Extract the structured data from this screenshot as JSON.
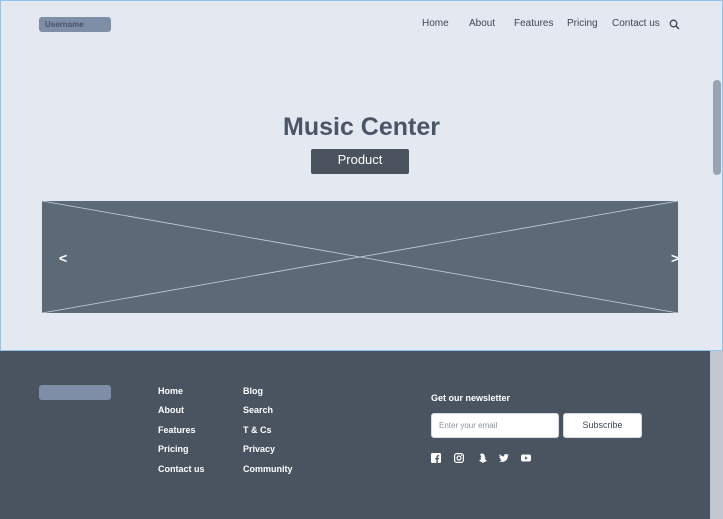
{
  "header": {
    "username": "Username",
    "nav": [
      {
        "label": "Home"
      },
      {
        "label": "About"
      },
      {
        "label": "Features"
      },
      {
        "label": "Pricing"
      },
      {
        "label": "Contact us"
      }
    ],
    "search_icon": "search-icon"
  },
  "hero": {
    "title": "Music Center",
    "button_label": "Product",
    "prev_arrow": "<",
    "next_arrow": ">"
  },
  "footer": {
    "col1": [
      {
        "label": "Home"
      },
      {
        "label": "About"
      },
      {
        "label": "Features"
      },
      {
        "label": "Pricing"
      },
      {
        "label": "Contact us"
      }
    ],
    "col2": [
      {
        "label": "Blog"
      },
      {
        "label": "Search"
      },
      {
        "label": "T & Cs"
      },
      {
        "label": "Privacy"
      },
      {
        "label": "Community"
      }
    ],
    "newsletter": {
      "heading": "Get our newsletter",
      "placeholder": "Enter your email",
      "subscribe_label": "Subscribe"
    },
    "social_icons": [
      "facebook-icon",
      "instagram-icon",
      "snapchat-icon",
      "twitter-icon",
      "youtube-icon"
    ]
  },
  "colors": {
    "page_bg": "#e4e8f1",
    "footer_bg": "#4a5360",
    "accent_dark": "#4a525d",
    "placeholder_gray": "#7f8ea7",
    "hero_bg": "#5c6a78"
  }
}
